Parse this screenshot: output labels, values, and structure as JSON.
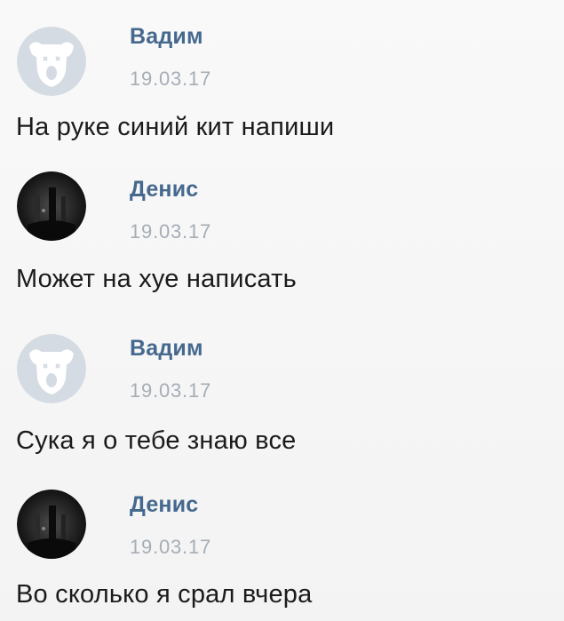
{
  "messages": [
    {
      "author": "Вадим",
      "avatar_icon": "vk-dog-avatar-icon",
      "date": "19.03.17",
      "text": "На руке синий кит напиши"
    },
    {
      "author": "Денис",
      "avatar_icon": "dark-photo-avatar-icon",
      "date": "19.03.17",
      "text": "Может на хуе написать"
    },
    {
      "author": "Вадим",
      "avatar_icon": "vk-dog-avatar-icon",
      "date": "19.03.17",
      "text": "Сука я о тебе знаю все"
    },
    {
      "author": "Денис",
      "avatar_icon": "dark-photo-avatar-icon",
      "date": "19.03.17",
      "text": "Во сколько я срал вчера"
    }
  ],
  "colors": {
    "author_name": "#45688e",
    "date": "#a6adb5",
    "message_text": "#1b1b1b",
    "background": "#f6f6f6"
  }
}
